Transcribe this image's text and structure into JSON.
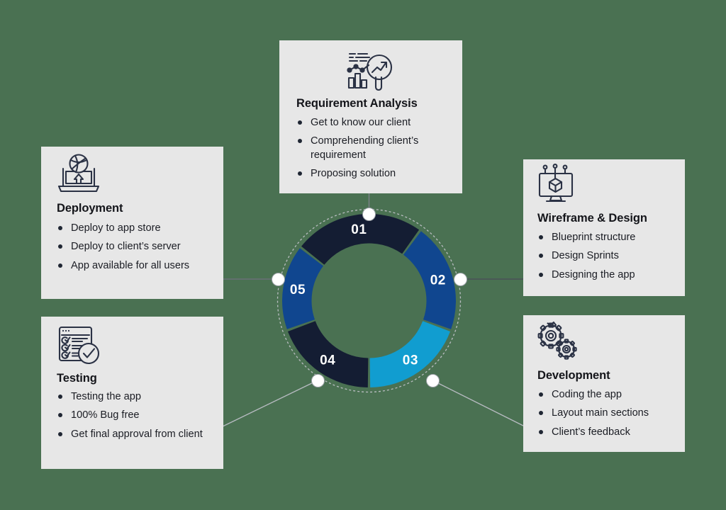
{
  "theme": {
    "background": "#4a7152",
    "card_background": "#e7e7e7",
    "icon_stroke": "#2b3245",
    "title_color": "#14151a",
    "text_color": "#1b1d24",
    "connector_color": "#8d9298",
    "node_fill": "#ffffff",
    "node_border": "#9aa0a6"
  },
  "wheel": {
    "type": "donut",
    "label": "App development process wheel",
    "segments": [
      {
        "number": "01",
        "color": "#141d33",
        "start_deg": -52,
        "end_deg": 36,
        "step": "Requirement Analysis"
      },
      {
        "number": "02",
        "color": "#10468f",
        "start_deg": 36,
        "end_deg": 110,
        "step": "Wireframe & Design"
      },
      {
        "number": "03",
        "color": "#119dd0",
        "start_deg": 110,
        "end_deg": 180,
        "step": "Development"
      },
      {
        "number": "04",
        "color": "#141d33",
        "start_deg": 180,
        "end_deg": 250,
        "step": "Testing"
      },
      {
        "number": "05",
        "color": "#10468f",
        "start_deg": 250,
        "end_deg": 308,
        "step": "Deployment"
      }
    ]
  },
  "cards": [
    {
      "id": "requirement-analysis",
      "icon": "chart-magnifier-icon",
      "title": "Requirement Analysis",
      "bullets": [
        "Get to know our client",
        "Comprehending client’s requirement",
        "Proposing solution"
      ]
    },
    {
      "id": "wireframe-design",
      "icon": "monitor-cube-icon",
      "title": "Wireframe & Design",
      "bullets": [
        "Blueprint structure",
        "Design Sprints",
        "Designing the app"
      ]
    },
    {
      "id": "development",
      "icon": "gears-icon",
      "title": "Development",
      "bullets": [
        "Coding the app",
        "Layout main sections",
        "Client’s feedback"
      ]
    },
    {
      "id": "testing",
      "icon": "checklist-check-icon",
      "title": "Testing",
      "bullets": [
        "Testing the app",
        "100% Bug free",
        "Get final approval from client"
      ]
    },
    {
      "id": "deployment",
      "icon": "laptop-globe-upload-icon",
      "title": "Deployment",
      "bullets": [
        "Deploy to app store",
        "Deploy to client’s server",
        "App available for all users"
      ]
    }
  ]
}
